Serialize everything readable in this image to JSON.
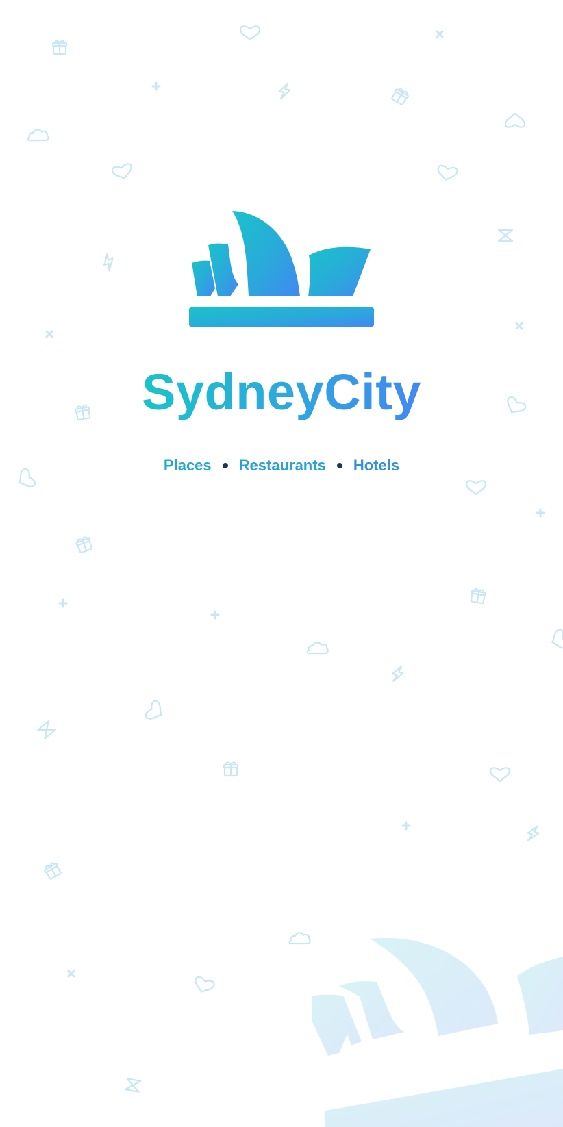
{
  "brand": {
    "name": "SydneyCity",
    "logo_icon": "opera-house-icon",
    "gradient": [
      "#19c3c9",
      "#4288f2"
    ]
  },
  "tagline": {
    "items": [
      "Places",
      "Restaurants",
      "Hotels"
    ],
    "separator_color": "#1d3557"
  },
  "background": {
    "pattern_color": "#c9e6f3",
    "pattern_icons": [
      "heart-icon",
      "gift-icon",
      "cloud-icon",
      "lightning-icon",
      "plus-icon",
      "cross-icon"
    ],
    "watermark_icon": "opera-house-watermark-icon"
  }
}
